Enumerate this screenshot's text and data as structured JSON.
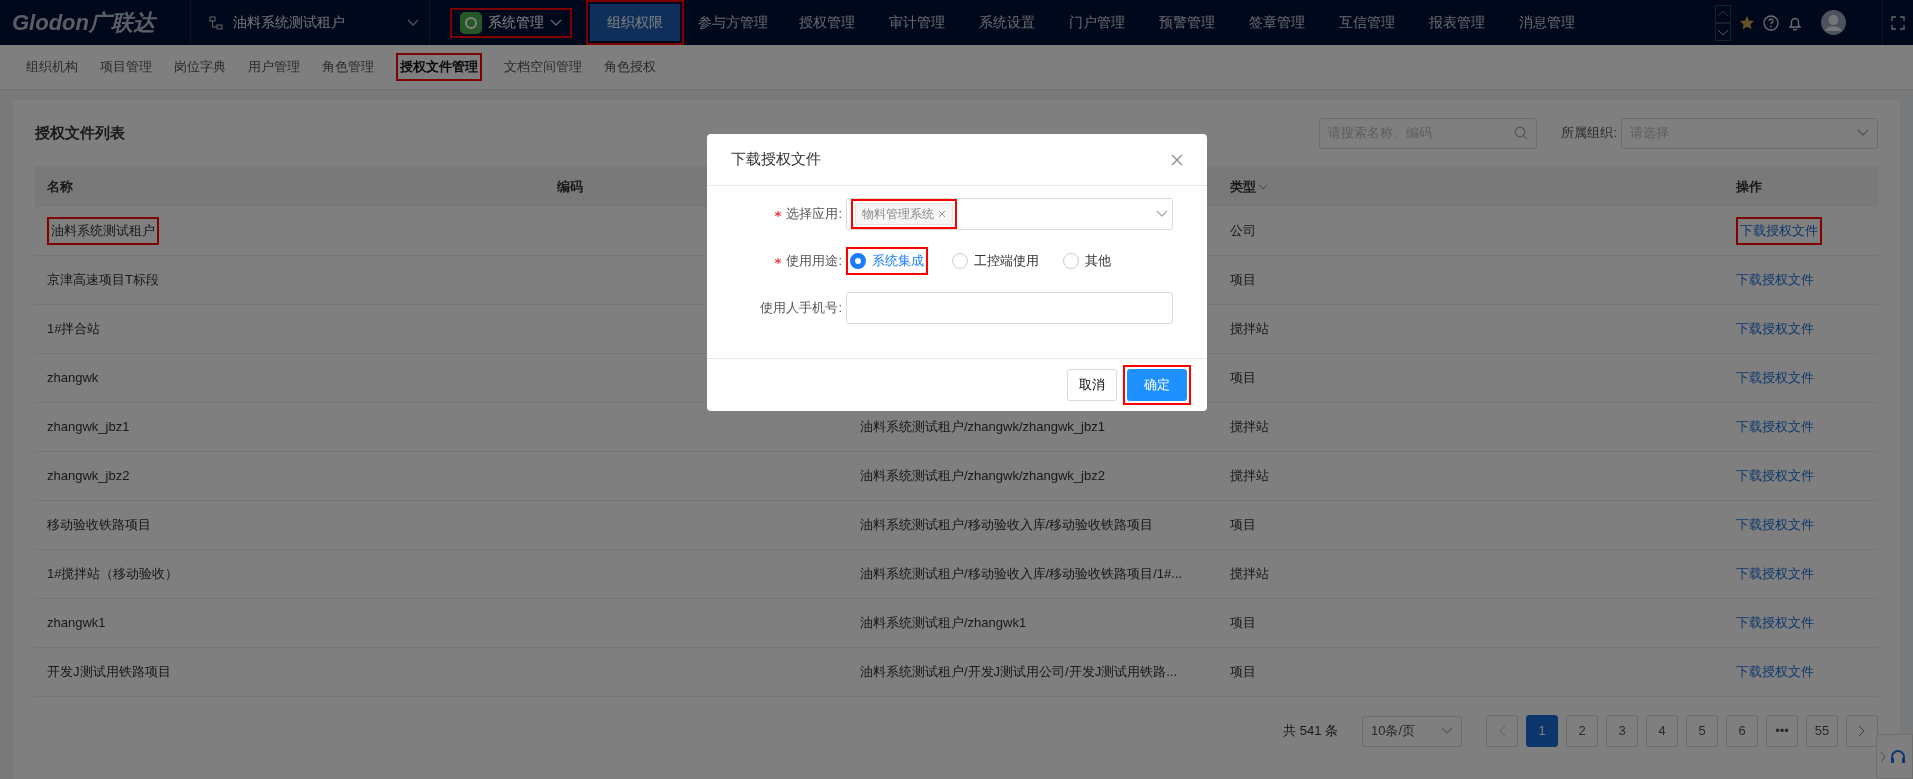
{
  "header": {
    "logo": "Glodon广联达",
    "tenant": "油料系统测试租户",
    "app": {
      "label": "系统管理",
      "marked": true
    },
    "nav": [
      {
        "label": "组织权限",
        "selected": true,
        "marked": true
      },
      {
        "label": "参与方管理",
        "selected": false,
        "marked": false
      },
      {
        "label": "授权管理",
        "selected": false,
        "marked": false
      },
      {
        "label": "审计管理",
        "selected": false,
        "marked": false
      },
      {
        "label": "系统设置",
        "selected": false,
        "marked": false
      },
      {
        "label": "门户管理",
        "selected": false,
        "marked": false
      },
      {
        "label": "预警管理",
        "selected": false,
        "marked": false
      },
      {
        "label": "签章管理",
        "selected": false,
        "marked": false
      },
      {
        "label": "互信管理",
        "selected": false,
        "marked": false
      },
      {
        "label": "报表管理",
        "selected": false,
        "marked": false
      },
      {
        "label": "消息管理",
        "selected": false,
        "marked": false
      }
    ]
  },
  "subnav": [
    {
      "label": "组织机构",
      "selected": false,
      "marked": false
    },
    {
      "label": "项目管理",
      "selected": false,
      "marked": false
    },
    {
      "label": "岗位字典",
      "selected": false,
      "marked": false
    },
    {
      "label": "用户管理",
      "selected": false,
      "marked": false
    },
    {
      "label": "角色管理",
      "selected": false,
      "marked": false
    },
    {
      "label": "授权文件管理",
      "selected": true,
      "marked": true
    },
    {
      "label": "文档空间管理",
      "selected": false,
      "marked": false
    },
    {
      "label": "角色授权",
      "selected": false,
      "marked": false
    }
  ],
  "list": {
    "title": "授权文件列表",
    "search": {
      "placeholder": "请搜索名称、编码"
    },
    "org_filter": {
      "label": "所属组织:",
      "placeholder": "请选择"
    },
    "columns": {
      "name": "名称",
      "code": "编码",
      "type": "类型",
      "action": "操作"
    },
    "rows": [
      {
        "name": "油料系统测试租户",
        "type": "公司",
        "action": "下载授权文件",
        "marked": true
      },
      {
        "name": "京津高速项目T标段",
        "type": "项目",
        "action": "下载授权文件",
        "marked": false
      },
      {
        "name": "1#拌合站",
        "type": "搅拌站",
        "action": "下载授权文件",
        "marked": false
      },
      {
        "name": "zhangwk",
        "type": "项目",
        "action": "下载授权文件",
        "marked": false
      },
      {
        "name": "zhangwk_jbz1",
        "path": "油料系统测试租户/zhangwk/zhangwk_jbz1",
        "type": "搅拌站",
        "action": "下载授权文件",
        "marked": false
      },
      {
        "name": "zhangwk_jbz2",
        "path": "油料系统测试租户/zhangwk/zhangwk_jbz2",
        "type": "搅拌站",
        "action": "下载授权文件",
        "marked": false
      },
      {
        "name": "移动验收铁路项目",
        "path": "油料系统测试租户/移动验收入库/移动验收铁路项目",
        "type": "项目",
        "action": "下载授权文件",
        "marked": false
      },
      {
        "name": "1#搅拌站（移动验收）",
        "path": "油料系统测试租户/移动验收入库/移动验收铁路项目/1#...",
        "type": "搅拌站",
        "action": "下载授权文件",
        "marked": false
      },
      {
        "name": "zhangwk1",
        "path": "油料系统测试租户/zhangwk1",
        "type": "项目",
        "action": "下载授权文件",
        "marked": false
      },
      {
        "name": "开发J测试用铁路项目",
        "path": "油料系统测试租户/开发J测试用公司/开发J测试用铁路...",
        "type": "项目",
        "action": "下载授权文件",
        "marked": false
      }
    ],
    "pagination": {
      "total": "共 541 条",
      "page_size": "10条/页",
      "pages": [
        {
          "label": "1",
          "selected": true
        },
        {
          "label": "2",
          "selected": false
        },
        {
          "label": "3",
          "selected": false
        },
        {
          "label": "4",
          "selected": false
        },
        {
          "label": "5",
          "selected": false
        },
        {
          "label": "6",
          "selected": false
        },
        {
          "label": "•••",
          "selected": false
        },
        {
          "label": "55",
          "selected": false
        }
      ]
    }
  },
  "dialog": {
    "title": "下载授权文件",
    "app_field": {
      "label": "选择应用:",
      "required": true,
      "tag": "物料管理系统",
      "marked": true
    },
    "purpose_field": {
      "label": "使用用途:",
      "required": true,
      "options": [
        {
          "label": "系统集成",
          "selected": true,
          "marked": true
        },
        {
          "label": "工控端使用",
          "selected": false,
          "marked": false
        },
        {
          "label": "其他",
          "selected": false,
          "marked": false
        }
      ]
    },
    "phone_field": {
      "label": "使用人手机号:",
      "required": false
    },
    "cancel": "取消",
    "ok": {
      "label": "确定",
      "marked": true
    }
  }
}
